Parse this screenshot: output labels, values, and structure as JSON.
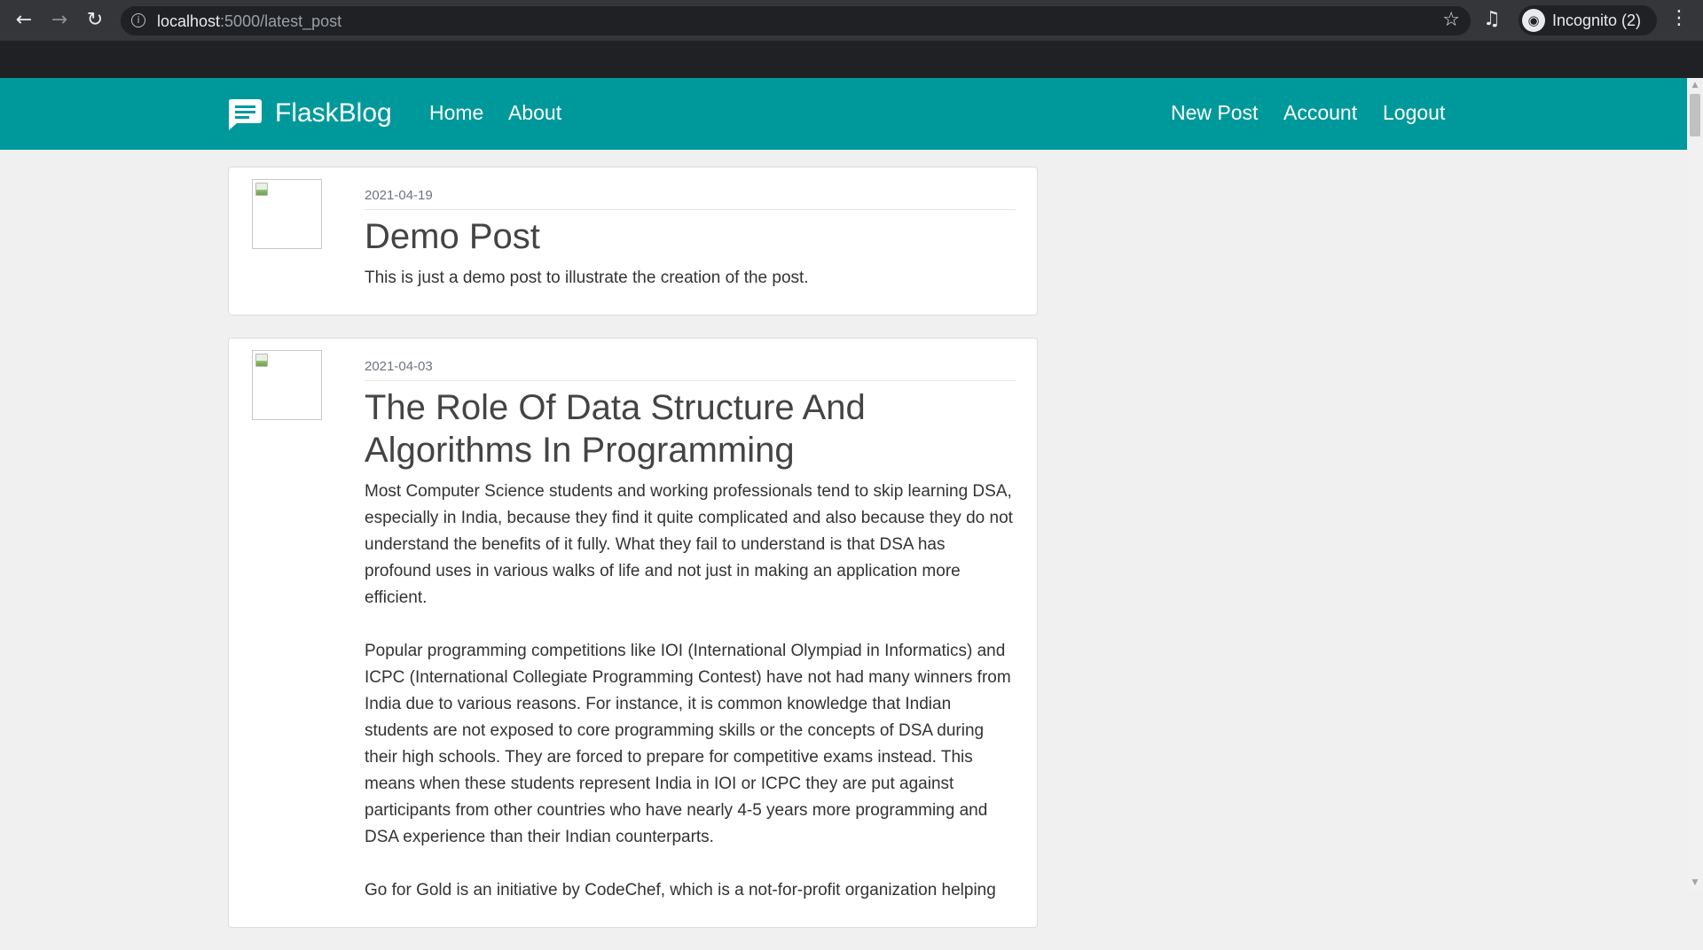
{
  "browser": {
    "url_host": "localhost",
    "url_rest": ":5000/latest_post",
    "profile_label": "Incognito (2)"
  },
  "navbar": {
    "brand": "FlaskBlog",
    "links_left": [
      "Home",
      "About"
    ],
    "links_right": [
      "New Post",
      "Account",
      "Logout"
    ],
    "color": "#00999b"
  },
  "posts": [
    {
      "date": "2021-04-19",
      "title": "Demo Post",
      "paragraphs": [
        "This is just a demo post to illustrate the creation of the post."
      ]
    },
    {
      "date": "2021-04-03",
      "title": "The Role Of Data Structure And Algorithms In Programming",
      "paragraphs": [
        "Most Computer Science students and working professionals tend to skip learning DSA, especially in India, because they find it quite complicated and also because they do not understand the benefits of it fully. What they fail to understand is that DSA has profound uses in various walks of life and not just in making an application more efficient.",
        "Popular programming competitions like IOI (International Olympiad in Informatics) and ICPC (International Collegiate Programming Contest) have not had many winners from India due to various reasons. For instance, it is common knowledge that Indian students are not exposed to core programming skills or the concepts of DSA during their high schools. They are forced to prepare for competitive exams instead. This means when these students represent India in IOI or ICPC they are put against participants from other countries who have nearly 4-5 years more programming and DSA experience than their Indian counterparts.",
        "Go for Gold is an initiative by CodeChef, which is a not-for-profit organization helping"
      ]
    }
  ]
}
